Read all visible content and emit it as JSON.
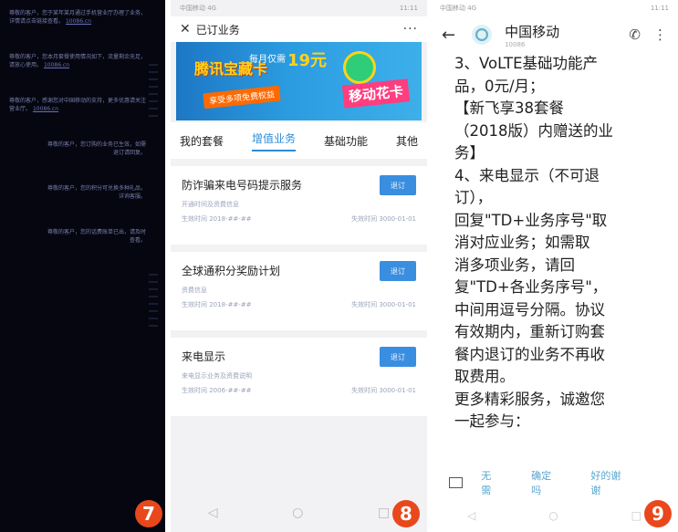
{
  "panel1": {
    "messages": [
      {
        "text": "尊敬的客户，您于某年某月通过手机营业厅办理了业务，详情请点击链接查看。",
        "link": "10086.cn",
        "align": "left"
      },
      {
        "text": "尊敬的客户，您本月套餐使用情况如下，流量剩余充足，请放心使用。",
        "link": "10086.cn",
        "align": "left"
      },
      {
        "text": "尊敬的客户，感谢您对中国移动的支持，更多优惠请关注营业厅。",
        "link": "10086.cn",
        "align": "left"
      },
      {
        "text": "尊敬的客户，您订购的业务已生效，如需退订请回复。",
        "link": "",
        "align": "right"
      },
      {
        "text": "尊敬的客户，您的积分可兑换多种礼品，详询客服。",
        "link": "",
        "align": "right"
      },
      {
        "text": "尊敬的客户，您的话费账单已出，请及时查看。",
        "link": "",
        "align": "right"
      }
    ],
    "badge": "7"
  },
  "panel2": {
    "status_left": "中国移动 4G",
    "status_right": "11:11",
    "title": "已订业务",
    "banner": {
      "brand": "腾讯宝藏卡",
      "price_prefix": "每月仅需",
      "price": "19元",
      "promo": "享受多项免费权益",
      "logo": "移动花卡"
    },
    "tabs": [
      {
        "label": "我的套餐",
        "active": false
      },
      {
        "label": "增值业务",
        "active": true
      },
      {
        "label": "基础功能",
        "active": false
      },
      {
        "label": "其他",
        "active": false
      }
    ],
    "services": [
      {
        "name": "防诈骗来电号码提示服务",
        "subtitle": "开通时间及资费信息",
        "start": "生效时间 2018-##-##",
        "end": "失效时间 3000-01-01",
        "button": "退订"
      },
      {
        "name": "全球通积分奖励计划",
        "subtitle": "资费信息",
        "start": "生效时间 2018-##-##",
        "end": "失效时间 3000-01-01",
        "button": "退订"
      },
      {
        "name": "来电显示",
        "subtitle": "来电显示业务及资费说明",
        "start": "生效时间 2006-##-##",
        "end": "失效时间 3000-01-01",
        "button": "退订"
      }
    ],
    "badge": "8"
  },
  "panel3": {
    "status_left": "中国移动 4G",
    "status_right": "11:11",
    "contact": "中国移动",
    "number": "10086",
    "message_lines": [
      "3、VoLTE基础功能产",
      "品，0元/月；",
      "【新飞享38套餐",
      "（2018版）内赠送的业",
      "务】",
      "4、来电显示（不可退",
      "订），",
      "回复\"TD+业务序号\"取",
      "消对应业务；如需取",
      "消多项业务，请回",
      "复\"TD+各业务序号\"，",
      "中间用逗号分隔。协议",
      "有效期内，重新订购套",
      "餐内退订的业务不再收",
      "取费用。",
      "更多精彩服务，诚邀您",
      "一起参与："
    ],
    "quick_replies": [
      "无需",
      "确定吗",
      "好的谢谢"
    ],
    "badge": "9"
  },
  "colors": {
    "badge": "#e8481c",
    "accent_blue": "#2b8cd8",
    "button_blue": "#3a8ee0",
    "dark_bg": "#05060f"
  }
}
